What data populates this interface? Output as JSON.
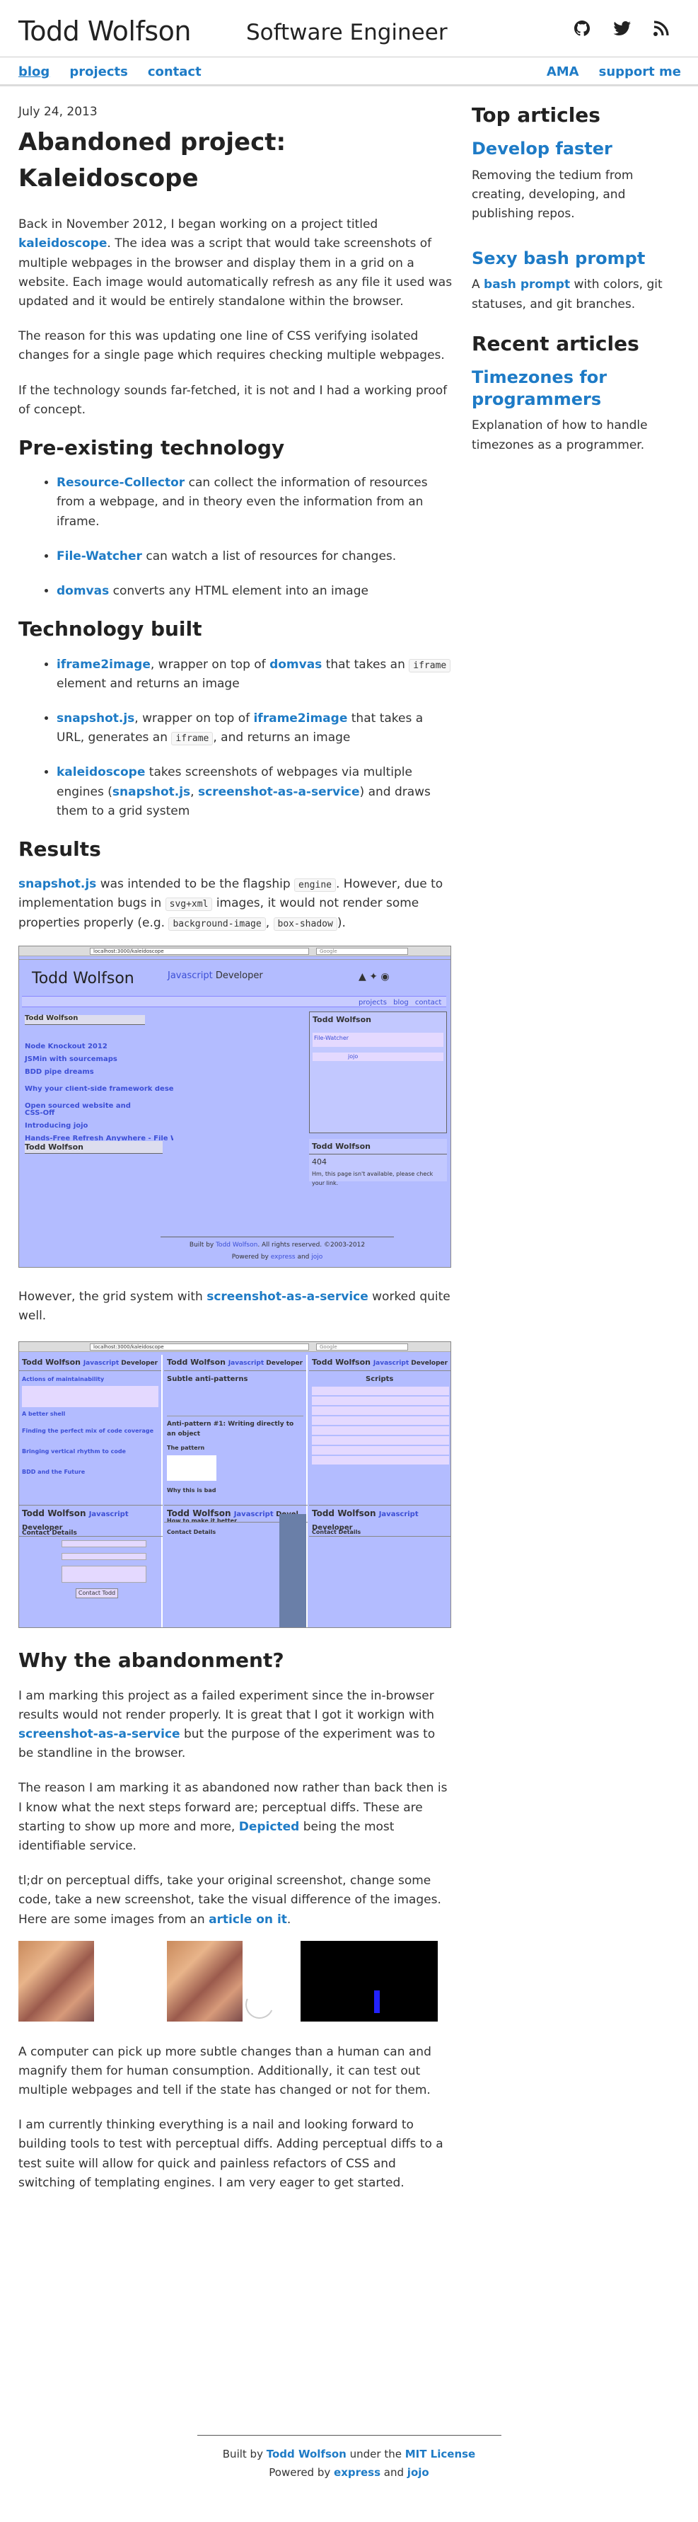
{
  "header": {
    "site_name": "Todd Wolfson",
    "role": "Software Engineer",
    "icons": [
      "github-icon",
      "twitter-icon",
      "rss-icon"
    ]
  },
  "nav": {
    "left": [
      "blog",
      "projects",
      "contact"
    ],
    "right": [
      "AMA",
      "support me"
    ]
  },
  "post": {
    "date": "July 24, 2013",
    "title": "Abandoned project: Kaleidoscope",
    "intro_1a": "Back in November 2012, I began working on a project titled ",
    "intro_1_link": "kaleidoscope",
    "intro_1b": ". The idea was a script that would take screenshots of multiple webpages in the browser and display them in a grid on a website. Each image would automatically refresh as any file it used was updated and it would be entirely standalone within the browser.",
    "intro_2": "The reason for this was updating one line of CSS verifying isolated changes for a single page which requires checking multiple webpages.",
    "intro_3": "If the technology sounds far-fetched, it is not and I had a working proof of concept.",
    "h_preexisting": "Pre-existing technology",
    "pre": [
      {
        "link": "Resource-Collector",
        "text": " can collect the information of resources from a webpage, and in theory even the information from an iframe."
      },
      {
        "link": "File-Watcher",
        "text": " can watch a list of resources for changes."
      },
      {
        "link": "domvas",
        "text": " converts any HTML element into an image"
      }
    ],
    "h_built": "Technology built",
    "built_1": {
      "link": "iframe2image",
      "a": ", wrapper on top of ",
      "link2": "domvas",
      "b": " that takes an ",
      "code": "iframe",
      "c": " element and returns an image"
    },
    "built_2": {
      "link": "snapshot.js",
      "a": ", wrapper on top of ",
      "link2": "iframe2image",
      "b": " that takes a URL, generates an ",
      "code": "iframe",
      "c": ", and returns an image"
    },
    "built_3": {
      "link": "kaleidoscope",
      "a": " takes screenshots of webpages via multiple engines (",
      "link2": "snapshot.js",
      "sep": ", ",
      "link3": "screenshot-as-a-service",
      "b": ") and draws them to a grid system"
    },
    "h_results": "Results",
    "results": {
      "link": "snapshot.js",
      "a": " was intended to be the flagship ",
      "code1": "engine",
      "b": ". However, due to implementation bugs in ",
      "code2": "svg+xml",
      "c": " images, it would not render some properties properly (e.g. ",
      "code3": "background-image",
      "d": ", ",
      "code4": "box-shadow",
      "e": ")."
    },
    "shot1": {
      "url": "localhost:3000/kaleidoscope",
      "search": "Google",
      "name": "Todd Wolfson",
      "role_blue": "Javascript",
      "role_rest": " Developer",
      "nav": [
        "projects",
        "blog",
        "contact"
      ],
      "list": [
        "Node Knockout 2012",
        "JSMin with sourcemaps",
        "BDD pipe dreams",
        "Why your client-side framework deserves a",
        "Open sourced website and CSS-Off",
        "Introducing jojo",
        "Hands-Free Refresh Anywhere - File Watch"
      ],
      "sidebar_items": [
        "File-Watcher",
        "jojo"
      ],
      "e404": "404",
      "e404_text": "Hm, this page isn't available, please check your link.",
      "footer_a": "Built by ",
      "footer_link": "Todd Wolfson",
      "footer_b": ". All rights reserved. ©2003-2012",
      "footer2_a": "Powered by ",
      "footer2_l1": "express",
      "footer2_and": " and ",
      "footer2_l2": "jojo"
    },
    "after_shot1_a": "However, the grid system with ",
    "after_shot1_link": "screenshot-as-a-service",
    "after_shot1_b": " worked quite well.",
    "shot2": {
      "url": "localhost:3000/kaleidoscope",
      "search": "Google",
      "col1": [
        "Actions of maintainability",
        "A better shell",
        "Finding the perfect mix of code coverage",
        "Bringing vertical rhythm to code",
        "BDD and the Future"
      ],
      "col2_head": "Subtle anti-patterns",
      "col2_sub": "Anti-pattern #1: Writing directly to an object",
      "col2_p1": "The pattern",
      "col2_p2": "Why this is bad",
      "col2_p3": "How to make it better",
      "col2_p4": "Contact Details",
      "col3_head": "Scripts",
      "contact": "Contact Details",
      "send": "Contact Todd",
      "name_short": "Todd Wolfson",
      "role_blue": "Javascript",
      "role_rest": " Developer",
      "role_cut": " Devel"
    },
    "h_why": "Why the abandonment?",
    "why_1a": "I am marking this project as a failed experiment since the in-browser results would not render properly. It is great that I got it workign with ",
    "why_1_link": "screenshot-as-a-service",
    "why_1b": " but the purpose of the experiment was to be standline in the browser.",
    "why_2a": "The reason I am marking it as abandoned now rather than back then is I know what the next steps forward are; perceptual diffs. These are starting to show up more and more, ",
    "why_2_link": "Depicted",
    "why_2b": " being the most identifiable service.",
    "why_3a": "tl;dr on perceptual diffs, take your original screenshot, change some code, take a new screenshot, take the visual difference of the images. Here are some images from an ",
    "why_3_link": "article on it",
    "why_3b": ".",
    "why_4": "A computer can pick up more subtle changes than a human can and magnify them for human consumption. Additionally, it can test out multiple webpages and tell if the state has changed or not for them.",
    "why_5": "I am currently thinking everything is a nail and looking forward to building tools to test with perceptual diffs. Adding perceptual diffs to a test suite will allow for quick and painless refactors of CSS and switching of templating engines. I am very eager to get started."
  },
  "sidebar": {
    "top_heading": "Top articles",
    "top": [
      {
        "title": "Develop faster",
        "desc": "Removing the tedium from creating, developing, and publishing repos."
      },
      {
        "title": "Sexy bash prompt",
        "desc_a": "A ",
        "desc_link": "bash prompt",
        "desc_b": " with colors, git statuses, and git branches."
      }
    ],
    "recent_heading": "Recent articles",
    "recent": [
      {
        "title": "Timezones for programmers",
        "desc": "Explanation of how to handle timezones as a programmer."
      }
    ]
  },
  "footer": {
    "line1_a": "Built by ",
    "line1_link1": "Todd Wolfson",
    "line1_b": " under the ",
    "line1_link2": "MIT License",
    "line2_a": "Powered by ",
    "line2_link1": "express",
    "line2_b": " and ",
    "line2_link2": "jojo"
  },
  "colors": {
    "link": "#1e7bc6",
    "text": "#333333",
    "shot_bg": "#b3bcff",
    "shot_accent": "#3c4fd6"
  }
}
